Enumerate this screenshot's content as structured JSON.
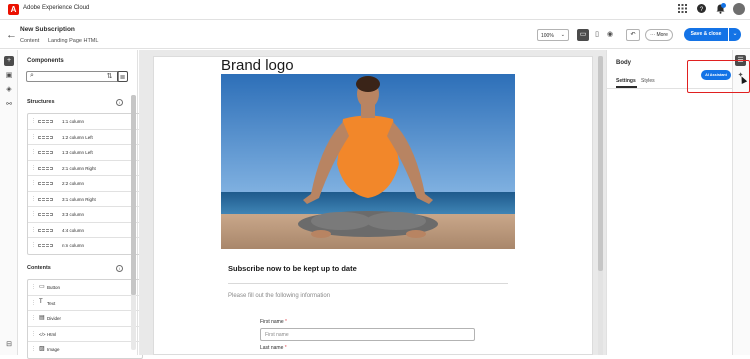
{
  "app": {
    "title": "Adobe Experience Cloud",
    "logo_letter": "A"
  },
  "topbar_icons": [
    "grid-icon",
    "help-icon",
    "bell-icon",
    "avatar"
  ],
  "header": {
    "title": "New Subscription",
    "breadcrumbs": [
      "Content",
      "Landing Page HTML"
    ],
    "zoom": "100%",
    "more_label": "More",
    "save_label": "Save & close",
    "undo_symbol": "↶"
  },
  "components": {
    "title": "Components",
    "search_placeholder": "",
    "structures_title": "Structures",
    "structures": [
      "1:1 column",
      "1:2 column Left",
      "1:3 column Left",
      "2:1 column Right",
      "2:2 column",
      "3:1 column Right",
      "3:3 column",
      "4:4 column",
      "n:n column"
    ],
    "contents_title": "Contents",
    "contents": [
      {
        "label": "Button",
        "icon": "▭"
      },
      {
        "label": "Text",
        "icon": "T"
      },
      {
        "label": "Divider",
        "icon": "▤"
      },
      {
        "label": "Html",
        "icon": "</>"
      },
      {
        "label": "Image",
        "icon": "▨"
      }
    ]
  },
  "canvas": {
    "brand_logo": "Brand logo",
    "subscribe_title": "Subscribe now to be kept up to date",
    "fill_info": "Please fill out the following information",
    "first_name_label": "First name",
    "first_name_placeholder": "First name",
    "last_name_label": "Last name",
    "required_mark": "*"
  },
  "right_panel": {
    "title": "Body",
    "tabs": [
      "Settings",
      "Styles"
    ],
    "ai_button": "AI Assistant"
  },
  "colors": {
    "accent": "#1473e6",
    "highlight": "#e02020",
    "brand_red": "#eb1000"
  }
}
